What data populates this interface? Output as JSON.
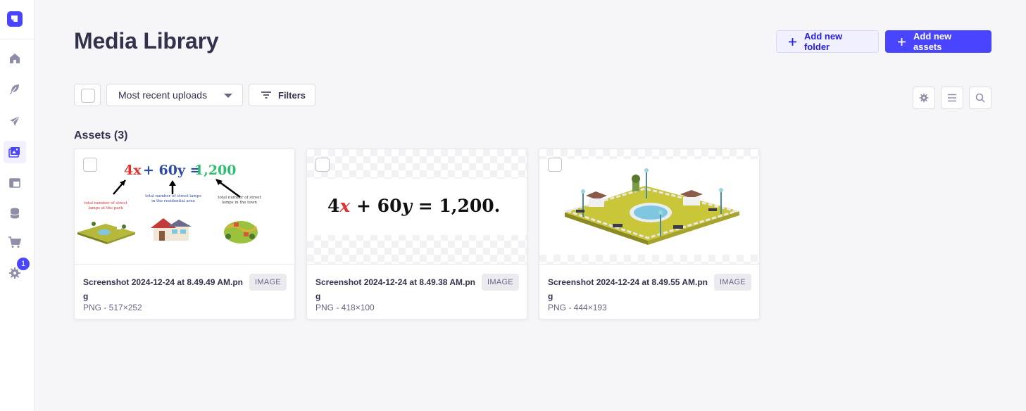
{
  "sidebar": {
    "badge_count": "1",
    "items": [
      {
        "name": "home",
        "icon": "house-icon"
      },
      {
        "name": "content-manager",
        "icon": "feather-icon"
      },
      {
        "name": "content-type-builder",
        "icon": "paper-plane-icon"
      },
      {
        "name": "media-library",
        "icon": "image-icon",
        "active": true
      },
      {
        "name": "layout",
        "icon": "layout-icon"
      },
      {
        "name": "database",
        "icon": "database-icon"
      },
      {
        "name": "marketplace",
        "icon": "cart-icon"
      },
      {
        "name": "settings",
        "icon": "gear-icon"
      }
    ]
  },
  "header": {
    "title": "Media Library",
    "add_folder_label": "Add new folder",
    "add_assets_label": "Add new assets"
  },
  "toolbar": {
    "sort_value": "Most recent uploads",
    "filters_label": "Filters"
  },
  "assets": {
    "heading": "Assets (3)",
    "items": [
      {
        "name": "Screenshot 2024-12-24 at 8.49.49 AM.png",
        "meta": "PNG - 517×252",
        "badge": "IMAGE",
        "thumb": {
          "equation_a": "4x",
          "equation_b": "+ 60y =",
          "equation_c": "1,200",
          "label1": "total number of street lamps at the park",
          "label2": "total number of street lamps in the residential area",
          "label3": "total number of street lamps in the town"
        }
      },
      {
        "name": "Screenshot 2024-12-24 at 8.49.38 AM.png",
        "meta": "PNG - 418×100",
        "badge": "IMAGE",
        "thumb": {
          "eq_1": "4",
          "eq_x": "x",
          "eq_rest": "+ 60",
          "eq_y": "y",
          "eq_end": "= 1,200."
        }
      },
      {
        "name": "Screenshot 2024-12-24 at 8.49.55 AM.png",
        "meta": "PNG - 444×193",
        "badge": "IMAGE"
      }
    ]
  },
  "colors": {
    "primary": "#4945ff",
    "background": "#f6f6f9",
    "text": "#32324d"
  }
}
